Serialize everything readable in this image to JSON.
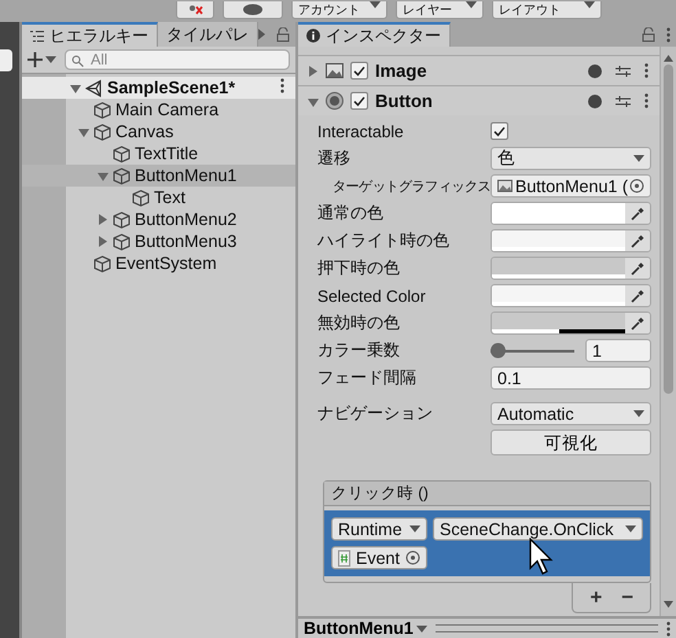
{
  "toolbar": {
    "dropdowns": [
      "アカウント",
      "レイヤー",
      "レイアウト"
    ]
  },
  "hierarchy": {
    "tabs": [
      {
        "label": "ヒエラルキー",
        "selected": true
      },
      {
        "label": "タイルパレ",
        "selected": false
      }
    ],
    "search": {
      "placeholder": "All"
    },
    "scene": {
      "name": "SampleScene1*",
      "expanded": true
    },
    "items": [
      {
        "name": "Main Camera",
        "selected": false
      },
      {
        "name": "Canvas",
        "expanded": true,
        "selected": false,
        "children": [
          {
            "name": "TextTitle",
            "selected": false
          },
          {
            "name": "ButtonMenu1",
            "expanded": true,
            "selected": true,
            "children": [
              {
                "name": "Text",
                "selected": false
              }
            ]
          },
          {
            "name": "ButtonMenu2",
            "expanded": false,
            "selected": false
          },
          {
            "name": "ButtonMenu3",
            "expanded": false,
            "selected": false
          }
        ]
      },
      {
        "name": "EventSystem",
        "selected": false
      }
    ]
  },
  "inspector": {
    "tab": "インスペクター",
    "components": [
      {
        "name": "Image",
        "expanded": false,
        "enabled": true
      },
      {
        "name": "Button",
        "expanded": true,
        "enabled": true
      }
    ],
    "properties": [
      {
        "kind": "checkbox",
        "label": "Interactable",
        "checked": true
      },
      {
        "kind": "dropdown",
        "label": "遷移",
        "value": "色"
      },
      {
        "kind": "object",
        "label": "ターゲットグラフィックス",
        "value": "ButtonMenu1 (",
        "indent": true
      },
      {
        "kind": "color",
        "label": "通常の色",
        "color": "#ffffff",
        "level": 1
      },
      {
        "kind": "color",
        "label": "ハイライト時の色",
        "color": "#f5f5f5",
        "level": 1
      },
      {
        "kind": "color",
        "label": "押下時の色",
        "color": "#c8c8c8",
        "level": 1
      },
      {
        "kind": "color",
        "label": "Selected Color",
        "color": "#f5f5f5",
        "level": 1
      },
      {
        "kind": "color",
        "label": "無効時の色",
        "color": "#c8c8c8",
        "level": 0.5
      },
      {
        "kind": "slider",
        "label": "カラー乗数",
        "level": 0,
        "value": "1"
      },
      {
        "kind": "number",
        "label": "フェード間隔",
        "value": "0.1"
      },
      {
        "kind": "dropdown",
        "label": "ナビゲーション",
        "value": "Automatic"
      },
      {
        "kind": "button",
        "value": "可視化"
      }
    ],
    "event": {
      "title": "クリック時 ()",
      "entries": [
        {
          "runtime": "Runtime",
          "function": "SceneChange.OnClick",
          "object": "Event",
          "selected": true
        }
      ],
      "buttons": [
        "+",
        "−"
      ]
    }
  },
  "bottom_bar": {
    "label": "ButtonMenu1"
  }
}
